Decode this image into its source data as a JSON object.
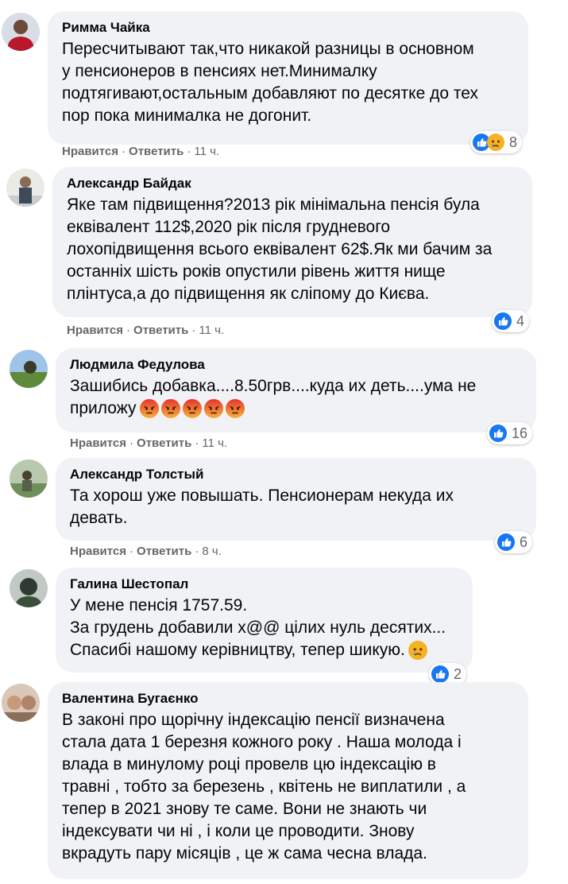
{
  "labels": {
    "like": "Нравится",
    "reply": "Ответить"
  },
  "colors": {
    "bubble": "#f0f2f5",
    "meta": "#65676b",
    "like_blue": "#1877f2"
  },
  "comments": [
    {
      "author": "Римма Чайка",
      "text": "Пересчитывают так,что никакой разницы в основном\nу пенсионеров в пенсиях нет.Минималку\nподтягивают,остальным добавляют по десятке до тех\nпор пока минималка не догонит.",
      "time": "11 ч.",
      "reactions": [
        "like-icon",
        "sad-icon"
      ],
      "count": "8"
    },
    {
      "author": "Александр Байдак",
      "text": "Яке там підвищення?2013 рік мінімальна пенсія була\nеквівалент 112$,2020 рік після грудневого\nлохопідвищення всього еквівалент 62$.Як ми бачим за\nостанніх шість років опустили рівень життя нище\nплінтуса,а до підвищення як сліпому до Києва.",
      "time": "11 ч.",
      "reactions": [
        "like-icon"
      ],
      "count": "4"
    },
    {
      "author": "Людмила Федулова",
      "text": "Зашибись добавка....8.50грв....куда их деть....ума не\nприложу",
      "emojis": [
        "angry-emoji",
        "angry-emoji",
        "angry-emoji",
        "angry-emoji",
        "angry-emoji"
      ],
      "time": "11 ч.",
      "reactions": [
        "like-icon"
      ],
      "count": "16"
    },
    {
      "author": "Александр Толстый",
      "text": "Та хорош уже повышать. Пенсионерам некуда их\nдевать.",
      "time": "8 ч.",
      "reactions": [
        "like-icon"
      ],
      "count": "6"
    },
    {
      "author": "Галина Шестопал",
      "text": "У мене пенсія 1757.59.\nЗа грудень добавили х@@ цілих нуль десятих...\nСпасибі нашому керівництву, тепер шикую.",
      "emojis": [
        "sad-emoji"
      ],
      "reactions": [
        "like-icon"
      ],
      "count": "2"
    },
    {
      "author": "Валентина Бугаєнко",
      "text": "В законі про щорічну індексацію пенсії визначена\nстала дата 1 березня кожного року . Наша молода і\nвлада в минулому році провелв цю індексацію в\nтравні , тобто за березень , квітень не виплатили , а\nтепер в 2021 знову те саме. Вони не знають чи\nіндексувати чи ні , і коли це проводити. Знову\nвкрадуть пару місяців , це ж сама чесна влада."
    }
  ]
}
